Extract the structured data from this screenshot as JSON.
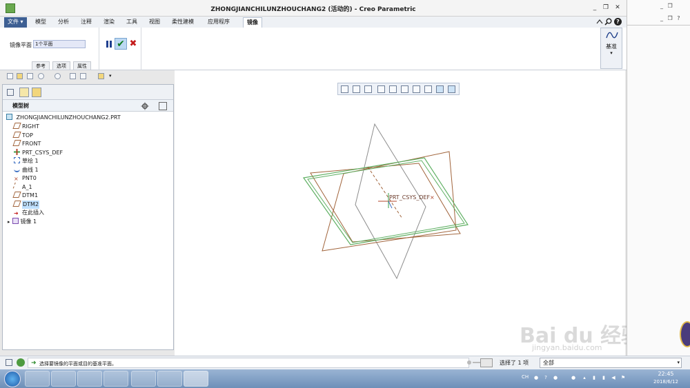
{
  "window": {
    "title": "ZHONGJIANCHILUNZHOUCHANG2 (活动的) - Creo Parametric",
    "controls": [
      "_",
      "❐",
      "✕"
    ],
    "help": "?"
  },
  "ribbon": {
    "tabs": [
      {
        "label": "文件",
        "dropdown": "▾"
      },
      {
        "label": "模型"
      },
      {
        "label": "分析"
      },
      {
        "label": "注释"
      },
      {
        "label": "渲染"
      },
      {
        "label": "工具"
      },
      {
        "label": "视图"
      },
      {
        "label": "柔性建模"
      },
      {
        "label": "应用程序"
      },
      {
        "label": "镜像"
      }
    ],
    "mirror_plane_label": "镜像平面",
    "mirror_plane_value": "1个平面",
    "sub_tabs": [
      "参考",
      "选项",
      "属性"
    ],
    "datum_label": "基准",
    "datum_arrow": "▾"
  },
  "panel": {
    "header": "模型树",
    "root": "ZHONGJIANCHILUNZHOUCHANG2.PRT",
    "items": [
      {
        "label": "RIGHT",
        "icon": "datum-plane-icon"
      },
      {
        "label": "TOP",
        "icon": "datum-plane-icon"
      },
      {
        "label": "FRONT",
        "icon": "datum-plane-icon"
      },
      {
        "label": "PRT_CSYS_DEF",
        "icon": "csys-icon"
      },
      {
        "label": "草绘 1",
        "icon": "sketch-icon"
      },
      {
        "label": "曲线 1",
        "icon": "curve-icon"
      },
      {
        "label": "PNT0",
        "icon": "point-icon"
      },
      {
        "label": "A_1",
        "icon": "axis-icon"
      },
      {
        "label": "DTM1",
        "icon": "datum-plane-icon"
      },
      {
        "label": "DTM2",
        "icon": "datum-plane-icon",
        "selected": true
      },
      {
        "label": "在此插入",
        "icon": "insert-arrow-icon"
      },
      {
        "label": "镜像 1",
        "icon": "mirror-feature-icon"
      }
    ],
    "expand_glyph": "▸"
  },
  "graphics": {
    "csys_label": "PRT_CSYS_DEF"
  },
  "status": {
    "message": "选择要镜像的平面或目的基准平面。",
    "selected": "选择了 1 项",
    "filter": "全部"
  },
  "taskbar": {
    "lang": "CH",
    "time": "22:45",
    "date": "2018/6/12"
  },
  "watermark": {
    "text": "Bai du 经验",
    "url": "jingyan.baidu.com"
  },
  "colors": {
    "accent": "#3d5f93",
    "ok_green": "#0d7a1b",
    "cancel_red": "#c41c1c",
    "selected": "#bfe0ff"
  }
}
